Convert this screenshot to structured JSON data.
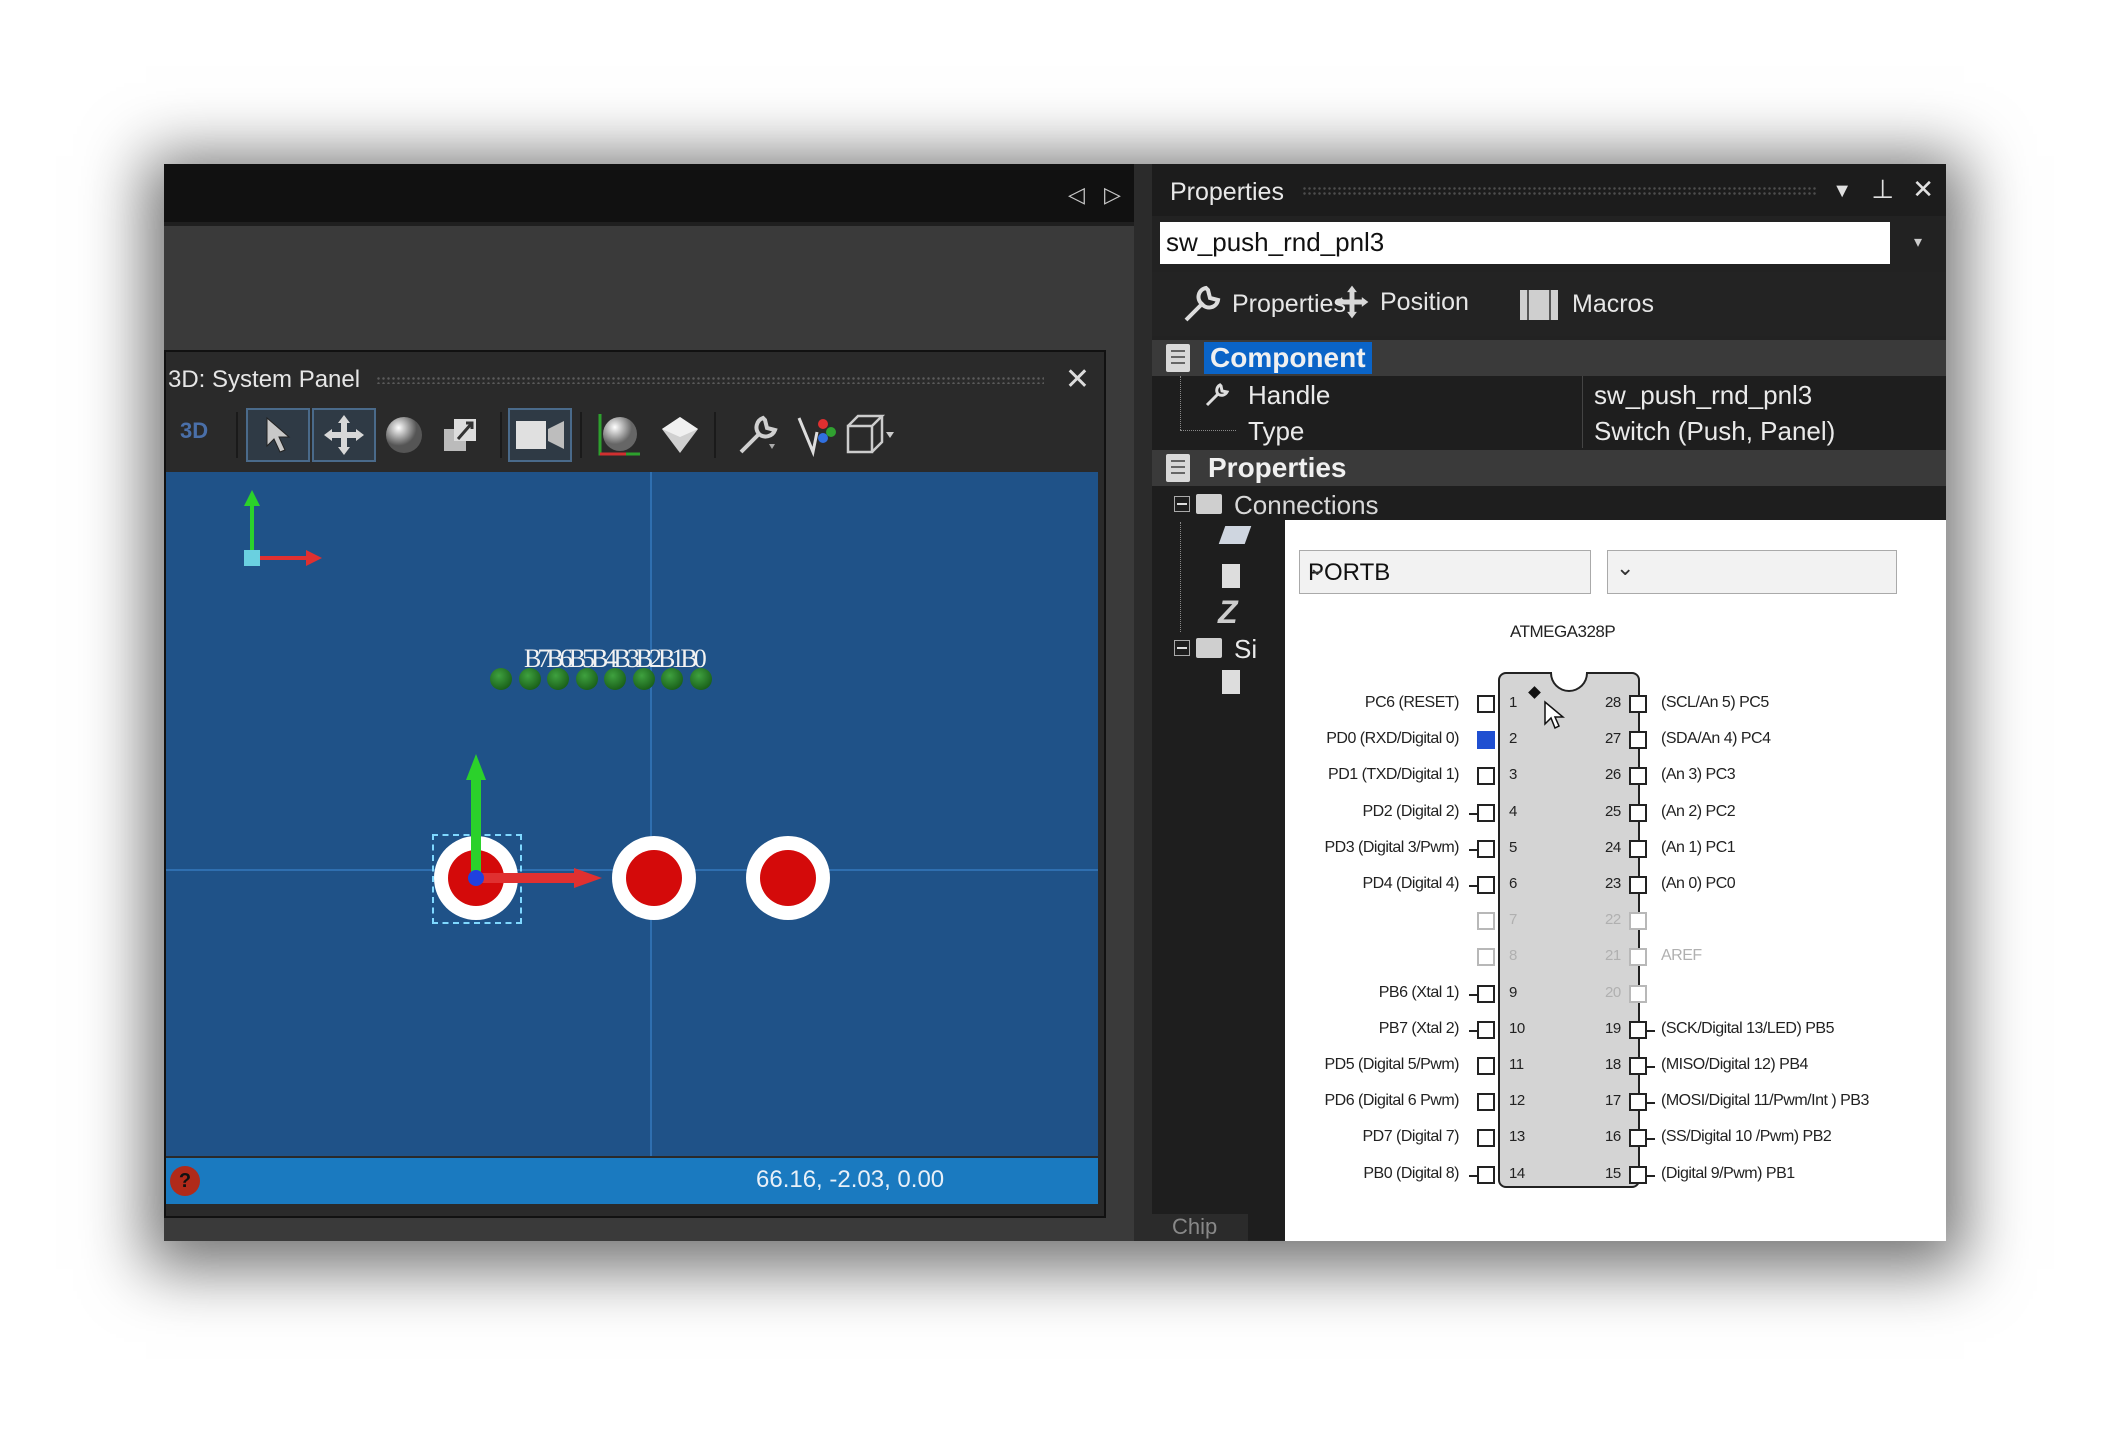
{
  "system_panel": {
    "title": "3D: System Panel",
    "toolbar_label": "3D",
    "bit_labels": "B7B6B5B4B3B2B1B0",
    "status_coords": "66.16, -2.03, 0.00",
    "help_glyph": "?",
    "close_glyph": "✕"
  },
  "nav": {
    "prev": "◁",
    "next": "▷"
  },
  "properties_panel": {
    "title": "Properties",
    "handle_value": "sw_push_rnd_pnl3",
    "tabs": [
      {
        "label": "Properties",
        "icon": "wrench-icon"
      },
      {
        "label": "Position",
        "icon": "move-icon"
      },
      {
        "label": "Macros",
        "icon": "macros-icon"
      }
    ],
    "component_category": "Component",
    "component_rows": [
      {
        "key": "Handle",
        "value": "sw_push_rnd_pnl3"
      },
      {
        "key": "Type",
        "value": "Switch (Push, Panel)"
      }
    ],
    "properties_category": "Properties",
    "connections_label": "Connections",
    "sim_label_partial": "Si",
    "z_partial": "Z",
    "chip_tab": "Chip"
  },
  "pin_popup": {
    "port_select": "PORTB",
    "second_select": "",
    "chip_name": "ATMEGA328P",
    "left_pins": [
      {
        "num": "1",
        "label": "PC6 (RESET)",
        "dim": false,
        "on": false,
        "stub": false
      },
      {
        "num": "2",
        "label": "PD0 (RXD/Digital 0)",
        "dim": false,
        "on": true,
        "stub": false
      },
      {
        "num": "3",
        "label": "PD1 (TXD/Digital 1)",
        "dim": false,
        "on": false,
        "stub": false
      },
      {
        "num": "4",
        "label": "PD2 (Digital 2)",
        "dim": false,
        "on": false,
        "stub": true
      },
      {
        "num": "5",
        "label": "PD3 (Digital 3/Pwm)",
        "dim": false,
        "on": false,
        "stub": true
      },
      {
        "num": "6",
        "label": "PD4 (Digital 4)",
        "dim": false,
        "on": false,
        "stub": true
      },
      {
        "num": "7",
        "label": "",
        "dim": true,
        "on": false,
        "stub": false
      },
      {
        "num": "8",
        "label": "",
        "dim": true,
        "on": false,
        "stub": false
      },
      {
        "num": "9",
        "label": "PB6 (Xtal 1)",
        "dim": false,
        "on": false,
        "stub": true
      },
      {
        "num": "10",
        "label": "PB7 (Xtal 2)",
        "dim": false,
        "on": false,
        "stub": true
      },
      {
        "num": "11",
        "label": "PD5 (Digital 5/Pwm)",
        "dim": false,
        "on": false,
        "stub": false
      },
      {
        "num": "12",
        "label": "PD6 (Digital 6 Pwm)",
        "dim": false,
        "on": false,
        "stub": false
      },
      {
        "num": "13",
        "label": "PD7 (Digital 7)",
        "dim": false,
        "on": false,
        "stub": false
      },
      {
        "num": "14",
        "label": "PB0 (Digital 8)",
        "dim": false,
        "on": false,
        "stub": true
      }
    ],
    "right_pins": [
      {
        "num": "28",
        "label": "(SCL/An 5) PC5",
        "dim": false,
        "stub": false
      },
      {
        "num": "27",
        "label": "(SDA/An 4) PC4",
        "dim": false,
        "stub": false
      },
      {
        "num": "26",
        "label": "(An 3) PC3",
        "dim": false,
        "stub": false
      },
      {
        "num": "25",
        "label": "(An 2) PC2",
        "dim": false,
        "stub": false
      },
      {
        "num": "24",
        "label": "(An 1) PC1",
        "dim": false,
        "stub": false
      },
      {
        "num": "23",
        "label": "(An 0) PC0",
        "dim": false,
        "stub": false
      },
      {
        "num": "22",
        "label": "",
        "dim": true,
        "stub": false
      },
      {
        "num": "21",
        "label": "AREF",
        "dim": true,
        "stub": false
      },
      {
        "num": "20",
        "label": "",
        "dim": true,
        "stub": false
      },
      {
        "num": "19",
        "label": "(SCK/Digital 13/LED) PB5",
        "dim": false,
        "stub": true
      },
      {
        "num": "18",
        "label": "(MISO/Digital 12) PB4",
        "dim": false,
        "stub": true
      },
      {
        "num": "17",
        "label": "(MOSI/Digital 11/Pwm/Int ) PB3",
        "dim": false,
        "stub": true
      },
      {
        "num": "16",
        "label": "(SS/Digital 10 /Pwm) PB2",
        "dim": false,
        "stub": true
      },
      {
        "num": "15",
        "label": "(Digital 9/Pwm) PB1",
        "dim": false,
        "stub": true
      }
    ]
  }
}
